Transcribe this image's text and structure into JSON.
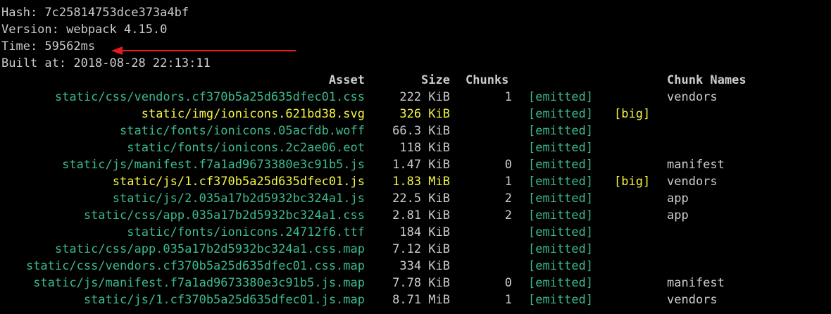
{
  "header": {
    "hash": "Hash: 7c25814753dce373a4bf",
    "version": "Version: webpack 4.15.0",
    "time": "Time: 59562ms",
    "built": "Built at: 2018-08-28 22:13:11"
  },
  "columns": {
    "asset": "Asset",
    "size": "Size",
    "chunks": "Chunks",
    "chunk_names": "Chunk Names"
  },
  "rows": [
    {
      "asset": "static/css/vendors.cf370b5a25d635dfec01.css",
      "size": "222 KiB",
      "chunks": "1",
      "emitted": "[emitted]",
      "big": "",
      "name": "vendors",
      "color": "#3cba8c",
      "size_color": "#cccccc"
    },
    {
      "asset": "static/img/ionicons.621bd38.svg",
      "size": "326 KiB",
      "chunks": "",
      "emitted": "[emitted]",
      "big": "[big]",
      "name": "",
      "color": "#f5f543",
      "size_color": "#f5f543"
    },
    {
      "asset": "static/fonts/ionicons.05acfdb.woff",
      "size": "66.3 KiB",
      "chunks": "",
      "emitted": "[emitted]",
      "big": "",
      "name": "",
      "color": "#3cba8c",
      "size_color": "#cccccc"
    },
    {
      "asset": "static/fonts/ionicons.2c2ae06.eot",
      "size": "118 KiB",
      "chunks": "",
      "emitted": "[emitted]",
      "big": "",
      "name": "",
      "color": "#3cba8c",
      "size_color": "#cccccc"
    },
    {
      "asset": "static/js/manifest.f7a1ad9673380e3c91b5.js",
      "size": "1.47 KiB",
      "chunks": "0",
      "emitted": "[emitted]",
      "big": "",
      "name": "manifest",
      "color": "#3cba8c",
      "size_color": "#cccccc"
    },
    {
      "asset": "static/js/1.cf370b5a25d635dfec01.js",
      "size": "1.83 MiB",
      "chunks": "1",
      "emitted": "[emitted]",
      "big": "[big]",
      "name": "vendors",
      "color": "#f5f543",
      "size_color": "#f5f543"
    },
    {
      "asset": "static/js/2.035a17b2d5932bc324a1.js",
      "size": "22.5 KiB",
      "chunks": "2",
      "emitted": "[emitted]",
      "big": "",
      "name": "app",
      "color": "#3cba8c",
      "size_color": "#cccccc"
    },
    {
      "asset": "static/css/app.035a17b2d5932bc324a1.css",
      "size": "2.81 KiB",
      "chunks": "2",
      "emitted": "[emitted]",
      "big": "",
      "name": "app",
      "color": "#3cba8c",
      "size_color": "#cccccc"
    },
    {
      "asset": "static/fonts/ionicons.24712f6.ttf",
      "size": "184 KiB",
      "chunks": "",
      "emitted": "[emitted]",
      "big": "",
      "name": "",
      "color": "#3cba8c",
      "size_color": "#cccccc"
    },
    {
      "asset": "static/css/app.035a17b2d5932bc324a1.css.map",
      "size": "7.12 KiB",
      "chunks": "",
      "emitted": "[emitted]",
      "big": "",
      "name": "",
      "color": "#3cba8c",
      "size_color": "#cccccc"
    },
    {
      "asset": "static/css/vendors.cf370b5a25d635dfec01.css.map",
      "size": "334 KiB",
      "chunks": "",
      "emitted": "[emitted]",
      "big": "",
      "name": "",
      "color": "#3cba8c",
      "size_color": "#cccccc"
    },
    {
      "asset": "static/js/manifest.f7a1ad9673380e3c91b5.js.map",
      "size": "7.78 KiB",
      "chunks": "0",
      "emitted": "[emitted]",
      "big": "",
      "name": "manifest",
      "color": "#3cba8c",
      "size_color": "#cccccc"
    },
    {
      "asset": "static/js/1.cf370b5a25d635dfec01.js.map",
      "size": "8.71 MiB",
      "chunks": "1",
      "emitted": "[emitted]",
      "big": "",
      "name": "vendors",
      "color": "#3cba8c",
      "size_color": "#cccccc"
    }
  ],
  "colors": {
    "background": "#000000",
    "text": "#cccccc",
    "green": "#3cba8c",
    "yellow": "#f5f543",
    "arrow": "#e31b1b"
  },
  "annotation": {
    "icon": "red-arrow-icon"
  }
}
